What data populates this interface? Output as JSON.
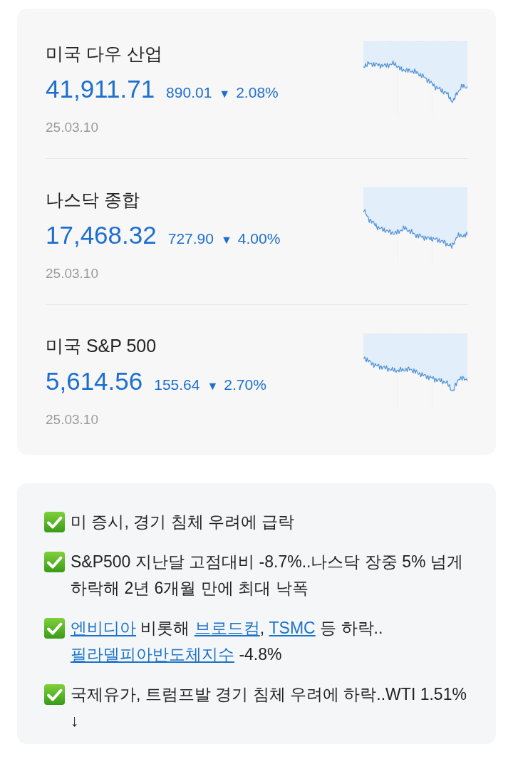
{
  "indices": [
    {
      "name": "미국 다우 산업",
      "value": "41,911.71",
      "change": "890.01",
      "arrow": "▼",
      "change_rate": "2.08%",
      "date": "25.03.10"
    },
    {
      "name": "나스닥 종합",
      "value": "17,468.32",
      "change": "727.90",
      "arrow": "▼",
      "change_rate": "4.00%",
      "date": "25.03.10"
    },
    {
      "name": "미국 S&P 500",
      "value": "5,614.56",
      "change": "155.64",
      "arrow": "▼",
      "change_rate": "2.70%",
      "date": "25.03.10"
    }
  ],
  "news": [
    {
      "parts": [
        {
          "kind": "text",
          "text": "미 증시, 경기 침체 우려에 급락"
        }
      ]
    },
    {
      "parts": [
        {
          "kind": "text",
          "text": "S&P500 지난달 고점대비 -8.7%..나스닥 장중 5% 넘게 하락해 2년 6개월 만에 최대 낙폭"
        }
      ]
    },
    {
      "parts": [
        {
          "kind": "link",
          "text": "엔비디아"
        },
        {
          "kind": "text",
          "text": " 비롯해 "
        },
        {
          "kind": "link",
          "text": "브로드컴"
        },
        {
          "kind": "text",
          "text": ", "
        },
        {
          "kind": "link",
          "text": "TSMC"
        },
        {
          "kind": "text",
          "text": " 등 하락.."
        },
        {
          "kind": "link",
          "text": "필라델피아반도체지수"
        },
        {
          "kind": "text",
          "text": " -4.8%"
        }
      ]
    },
    {
      "parts": [
        {
          "kind": "text",
          "text": "국제유가, 트럼프발 경기 침체 우려에 하락..WTI 1.51%↓"
        }
      ]
    }
  ]
}
